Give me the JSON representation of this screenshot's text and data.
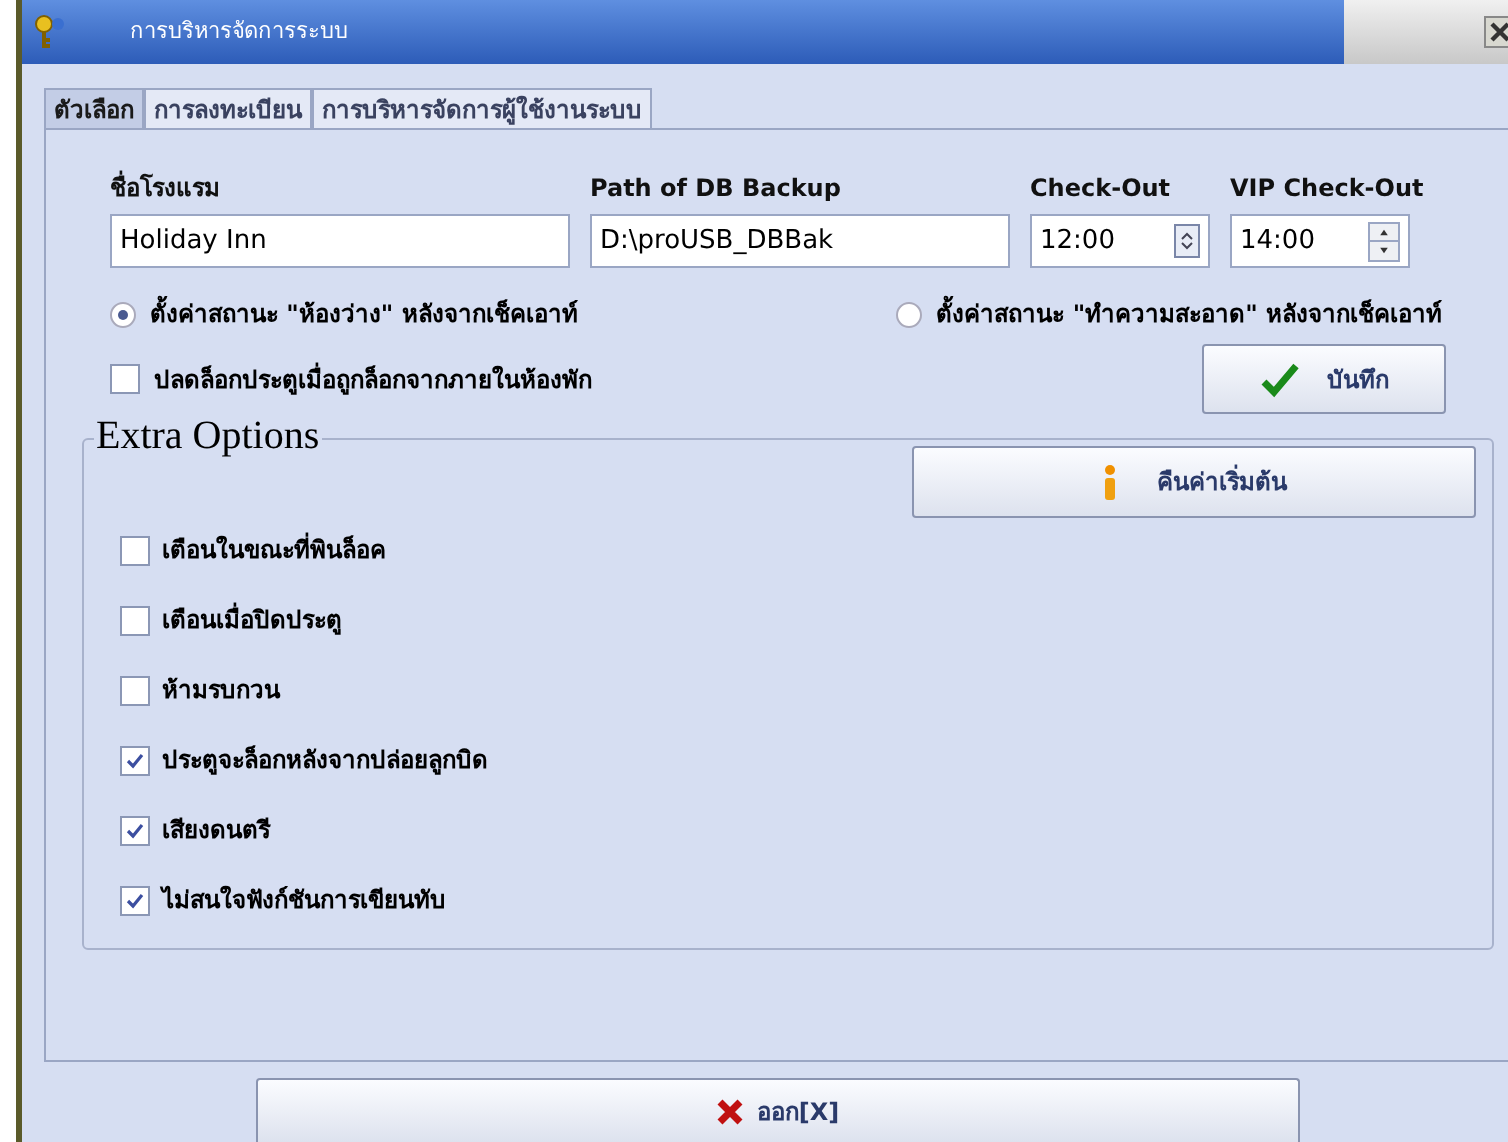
{
  "window": {
    "title": "การบริหารจัดการระบบ"
  },
  "tabs": [
    {
      "label": "ตัวเลือก",
      "selected": true
    },
    {
      "label": "การลงทะเบียน",
      "selected": false
    },
    {
      "label": "การบริหารจัดการผู้ใช้งานระบบ",
      "selected": false
    }
  ],
  "fields": [
    {
      "label": "ชื่อโรงแรม",
      "value": "Holiday Inn",
      "kind": "text"
    },
    {
      "label": "Path of DB Backup",
      "value": "D:\\proUSB_DBBak",
      "kind": "text"
    },
    {
      "label": "Check-Out",
      "value": "12:00",
      "kind": "dropdown"
    },
    {
      "label": "VIP Check-Out",
      "value": "14:00",
      "kind": "spinner"
    }
  ],
  "status_options": [
    {
      "label": "ตั้งค่าสถานะ \"ห้องว่าง\" หลังจากเช็คเอาท์",
      "selected": true
    },
    {
      "label": "ตั้งค่าสถานะ \"ทำความสะอาด\" หลังจากเช็คเอาท์",
      "selected": false
    }
  ],
  "unlock_option": {
    "label": "ปลดล็อกประตูเมื่อถูกล็อกจากภายในห้องพัก",
    "checked": false
  },
  "save_button": {
    "label": "บันทึก"
  },
  "extra_options": {
    "title": "Extra Options",
    "reset_button": {
      "label": "คืนค่าเริ่มต้น"
    },
    "items": [
      {
        "label": "เตือนในขณะที่พินล็อค",
        "checked": false
      },
      {
        "label": "เตือนเมื่อปิดประตู",
        "checked": false
      },
      {
        "label": "ห้ามรบกวน",
        "checked": false
      },
      {
        "label": "ประตูจะล็อกหลังจากปล่อยลูกบิด",
        "checked": true
      },
      {
        "label": "เสียงดนตรี",
        "checked": true
      },
      {
        "label": "ไม่สนใจฟังก์ชันการเขียนทับ",
        "checked": true
      }
    ]
  },
  "exit_button": {
    "label": "ออก[X]"
  }
}
